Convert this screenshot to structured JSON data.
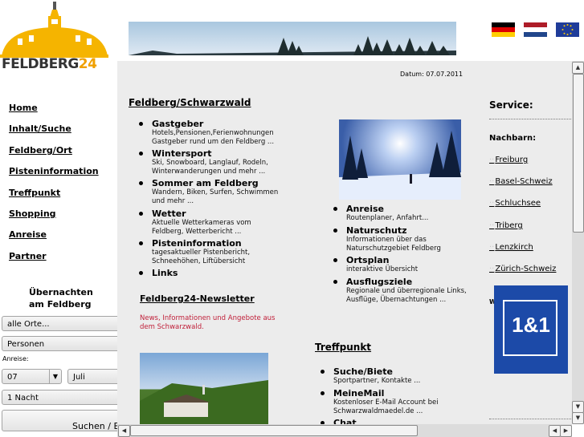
{
  "logo": {
    "part1": "FELDBERG",
    "part2": "24"
  },
  "flags": [
    "german-flag",
    "dutch-flag",
    "eu-flag"
  ],
  "nav": [
    "Home",
    "Inhalt/Suche",
    "Feldberg/Ort",
    "Pisteninformation",
    "Treffpunkt",
    "Shopping",
    "Anreise",
    "Partner"
  ],
  "booking": {
    "title": "Übernachten am Feldberg",
    "location": "alle Orte...",
    "persons": "Personen",
    "arrival_label": "Anreise:",
    "day": "07",
    "month": "Juli",
    "nights": "1 Nacht",
    "search": "Suchen / B"
  },
  "content": {
    "date": "Datum: 07.07.2011",
    "feldberg_heading": "Feldberg/Schwarzwald",
    "left_items": [
      {
        "title": "Gastgeber",
        "desc": "Hotels,Pensionen,Ferienwohnungen Gastgeber rund um den Feldberg ..."
      },
      {
        "title": "Wintersport",
        "desc": "Ski, Snowboard, Langlauf, Rodeln, Winterwanderungen und mehr ..."
      },
      {
        "title": "Sommer am Feldberg",
        "desc": "Wandern, Biken, Surfen, Schwimmen und mehr ..."
      },
      {
        "title": "Wetter",
        "desc": "Aktuelle Wetterkameras vom Feldberg, Wetterbericht ..."
      },
      {
        "title": "Pisteninformation",
        "desc": "tagesaktueller Pistenbericht, Schneehöhen, Liftübersicht"
      },
      {
        "title": "Links",
        "desc": ""
      }
    ],
    "newsletter_heading": "Feldberg24-Newsletter",
    "newsletter_text": "News, Informationen und Angebote aus dem Schwarzwald.",
    "right_items": [
      {
        "title": "Anreise",
        "desc": "Routenplaner, Anfahrt..."
      },
      {
        "title": "Naturschutz",
        "desc": "Informationen über das Naturschutzgebiet Feldberg"
      },
      {
        "title": "Ortsplan",
        "desc": "interaktive Übersicht"
      },
      {
        "title": "Ausflugsziele",
        "desc": "Regionale und überregionale Links, Ausflüge, Übernachtungen ..."
      }
    ],
    "treffpunkt_heading": "Treffpunkt",
    "treff_items": [
      {
        "title": "Suche/Biete",
        "desc": "Sportpartner, Kontakte ..."
      },
      {
        "title": "MeineMail",
        "desc": "Kostenloser E-Mail Account bei Schwarzwaldmaedel.de ..."
      },
      {
        "title": "Chat",
        "desc": ""
      }
    ]
  },
  "service": {
    "title": "Service:",
    "neighbors_label": "Nachbarn:",
    "links": [
      "Freiburg",
      "Basel-Schweiz",
      "Schluchsee",
      "Triberg",
      "Lenzkirch",
      "Zürich-Schweiz"
    ],
    "ad_text": "1&1",
    "stub": "W"
  }
}
